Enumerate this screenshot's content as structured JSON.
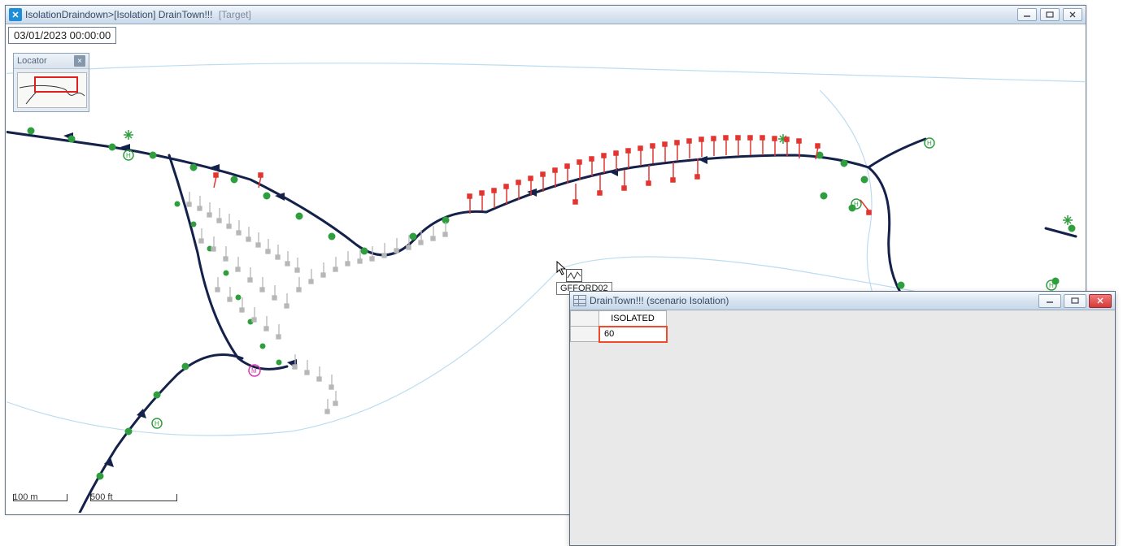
{
  "main_window": {
    "title_primary": "IsolationDraindown>[Isolation] DrainTown!!!",
    "title_secondary": "[Target]"
  },
  "timestamp": "03/01/2023 00:00:00",
  "locator": {
    "title": "Locator"
  },
  "scale": {
    "metric": "100 m",
    "imperial": "500 ft"
  },
  "hover": {
    "label": "GFFORD02"
  },
  "grid_window": {
    "title": "DrainTown!!! (scenario Isolation)",
    "columns": [
      "ISOLATED"
    ],
    "rows": [
      {
        "value": "60"
      }
    ]
  }
}
